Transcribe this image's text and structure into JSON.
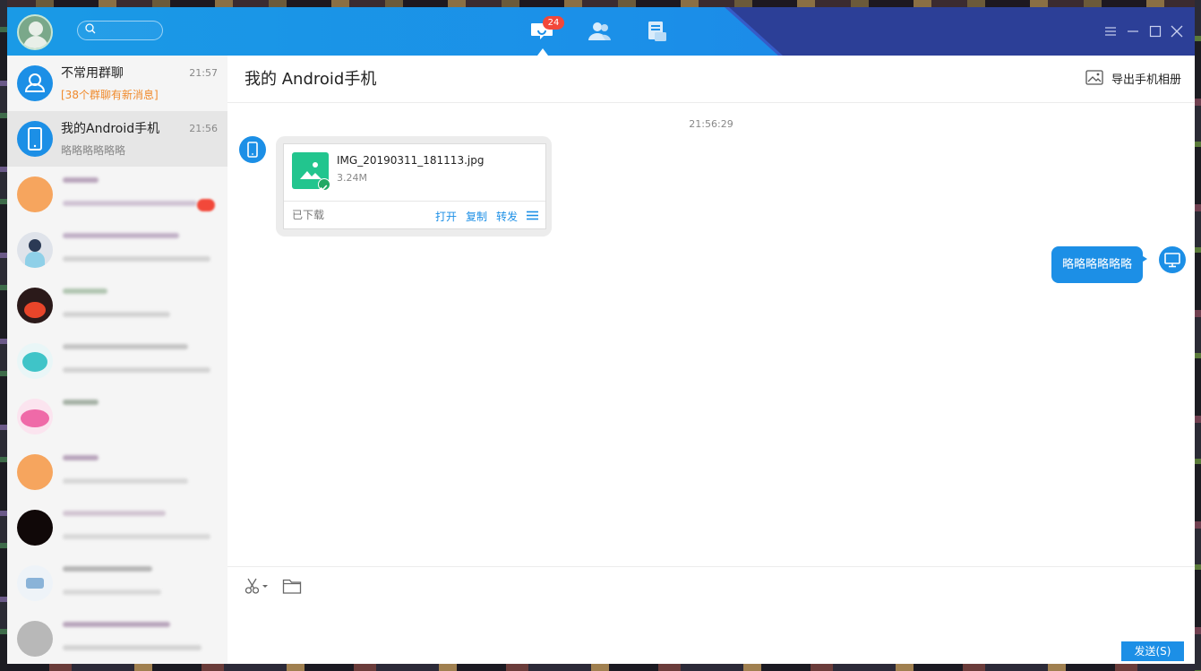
{
  "colors": {
    "accent": "#1c8fe6",
    "titlebar": "#1b8fe8",
    "titlebar_dark": "#2c3f97",
    "badge": "#f2483a",
    "alert_text": "#f08a2c",
    "file_thumb": "#22c58e"
  },
  "titlebar": {
    "avatar_icon": "user-avatar",
    "search_icon": "search-icon",
    "search": {
      "value": "",
      "placeholder": ""
    },
    "nav": [
      {
        "icon": "message-icon",
        "badge": "24",
        "active": true
      },
      {
        "icon": "contacts-icon"
      },
      {
        "icon": "files-icon"
      }
    ],
    "window_controls": [
      "menu-icon",
      "minimize-icon",
      "maximize-icon",
      "close-icon"
    ]
  },
  "sidebar": {
    "conversations": [
      {
        "name": "不常用群聊",
        "time": "21:57",
        "subtitle": "[38个群聊有新消息]",
        "subtitle_alert": true,
        "avatar_icon": "group-icon"
      },
      {
        "name": "我的Android手机",
        "time": "21:56",
        "subtitle": "略略略略略略",
        "active": true,
        "avatar_icon": "phone-icon"
      }
    ]
  },
  "chat": {
    "title": "我的 Android手机",
    "export_label": "导出手机相册",
    "export_icon": "photo-album-icon",
    "timestamp": "21:56:29",
    "incoming_file": {
      "filename": "IMG_20190311_181113.jpg",
      "size": "3.24M",
      "status": "已下载",
      "actions": [
        "打开",
        "复制",
        "转发"
      ],
      "thumb_icon": "image-file-icon",
      "more_icon": "hamburger-menu-icon"
    },
    "outgoing_message": "略略略略略略",
    "sender_icon": "desktop-icon",
    "receiver_icon": "phone-icon"
  },
  "input": {
    "tools": [
      "scissors-icon",
      "folder-icon"
    ],
    "send_label": "发送(S)"
  }
}
